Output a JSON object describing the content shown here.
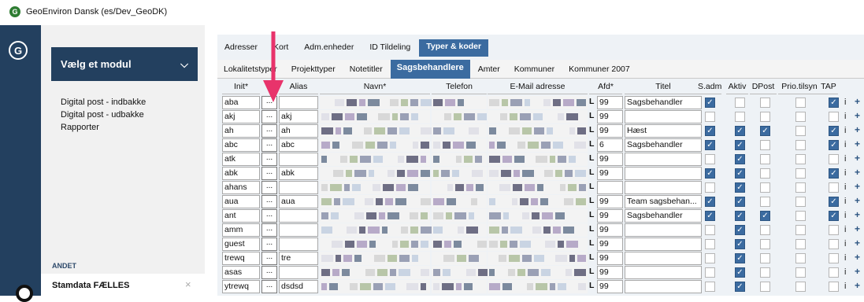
{
  "window": {
    "title": "GeoEnviron Dansk (es/Dev_GeoDK)",
    "app_icon_glyph": "G"
  },
  "rail": {
    "logo_glyph": "G"
  },
  "sidebar": {
    "module_select": {
      "label": "Vælg et modul",
      "icon": "chevron-down-icon"
    },
    "items": [
      {
        "label": "Digital post - indbakke"
      },
      {
        "label": "Digital post - udbakke"
      },
      {
        "label": "Rapporter"
      }
    ],
    "section_label": "ANDET",
    "stamdata": {
      "label": "Stamdata FÆLLES",
      "close_icon": "×"
    }
  },
  "tabs_main": [
    {
      "label": "Adresser",
      "active": false
    },
    {
      "label": "Kort",
      "active": false
    },
    {
      "label": "Adm.enheder",
      "active": false
    },
    {
      "label": "ID Tildeling",
      "active": false
    },
    {
      "label": "Typer & koder",
      "active": true
    }
  ],
  "tabs_sub": [
    {
      "label": "Lokalitetstyper",
      "active": false
    },
    {
      "label": "Projekttyper",
      "active": false
    },
    {
      "label": "Notetitler",
      "active": false
    },
    {
      "label": "Sagsbehandlere",
      "active": true
    },
    {
      "label": "Amter",
      "active": false
    },
    {
      "label": "Kommuner",
      "active": false
    },
    {
      "label": "Kommuner 2007",
      "active": false
    }
  ],
  "table": {
    "columns": [
      "Init*",
      "Alias",
      "Navn*",
      "Telefon",
      "E-Mail adresse",
      "Afd*",
      "Titel",
      "S.adm",
      "Aktiv",
      "DPost",
      "Prio.tilsyn",
      "TAP"
    ],
    "dots_label": "...",
    "afd_prefix": "L",
    "rows": [
      {
        "init": "aba",
        "alias": "",
        "afd": "99",
        "titel": "Sagsbehandler",
        "sadm": true,
        "aktiv": false,
        "dpost": false,
        "prio": false,
        "tap": true
      },
      {
        "init": "akj",
        "alias": "akj",
        "afd": "99",
        "titel": "",
        "sadm": false,
        "aktiv": false,
        "dpost": false,
        "prio": false,
        "tap": false
      },
      {
        "init": "ah",
        "alias": "ah",
        "afd": "99",
        "titel": "Hæst",
        "sadm": true,
        "aktiv": true,
        "dpost": true,
        "prio": false,
        "tap": true
      },
      {
        "init": "abc",
        "alias": "abc",
        "afd": "6",
        "titel": "Sagsbehandler",
        "sadm": true,
        "aktiv": true,
        "dpost": false,
        "prio": false,
        "tap": true
      },
      {
        "init": "atk",
        "alias": "",
        "afd": "99",
        "titel": "",
        "sadm": false,
        "aktiv": true,
        "dpost": false,
        "prio": false,
        "tap": false
      },
      {
        "init": "abk",
        "alias": "abk",
        "afd": "99",
        "titel": "",
        "sadm": true,
        "aktiv": true,
        "dpost": false,
        "prio": false,
        "tap": true
      },
      {
        "init": "ahans",
        "alias": "",
        "afd": "",
        "titel": "",
        "sadm": false,
        "aktiv": true,
        "dpost": false,
        "prio": false,
        "tap": false
      },
      {
        "init": "aua",
        "alias": "aua",
        "afd": "99",
        "titel": "Team sagsbehan...",
        "sadm": true,
        "aktiv": true,
        "dpost": false,
        "prio": false,
        "tap": true
      },
      {
        "init": "ant",
        "alias": "",
        "afd": "99",
        "titel": "Sagsbehandler",
        "sadm": true,
        "aktiv": true,
        "dpost": true,
        "prio": false,
        "tap": true
      },
      {
        "init": "amm",
        "alias": "",
        "afd": "99",
        "titel": "",
        "sadm": false,
        "aktiv": true,
        "dpost": false,
        "prio": false,
        "tap": false
      },
      {
        "init": "guest",
        "alias": "",
        "afd": "99",
        "titel": "",
        "sadm": false,
        "aktiv": true,
        "dpost": false,
        "prio": false,
        "tap": false
      },
      {
        "init": "trewq",
        "alias": "tre",
        "afd": "99",
        "titel": "",
        "sadm": false,
        "aktiv": true,
        "dpost": false,
        "prio": false,
        "tap": false
      },
      {
        "init": "asas",
        "alias": "",
        "afd": "99",
        "titel": "",
        "sadm": false,
        "aktiv": true,
        "dpost": false,
        "prio": false,
        "tap": false
      },
      {
        "init": "ytrewq",
        "alias": "dsdsd",
        "afd": "99",
        "titel": "",
        "sadm": false,
        "aktiv": true,
        "dpost": false,
        "prio": false,
        "tap": false
      }
    ],
    "row_icons": {
      "info": "i",
      "add": "+"
    }
  },
  "colors": {
    "accent": "#3b6ba0",
    "rail": "#23405f",
    "arrow": "#e8336b"
  }
}
